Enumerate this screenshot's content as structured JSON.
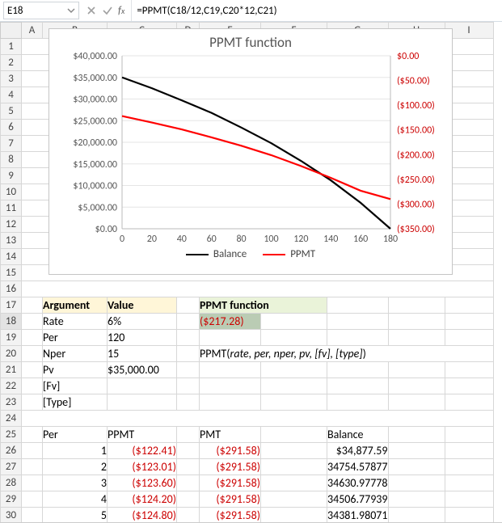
{
  "namebox": "E18",
  "formula": "=PPMT(C18/12,C19,C20*12,C21)",
  "col_headers": [
    "A",
    "B",
    "C",
    "D",
    "E",
    "F",
    "G",
    "H",
    "I"
  ],
  "row_headers": [
    "1",
    "2",
    "3",
    "4",
    "5",
    "6",
    "7",
    "8",
    "9",
    "10",
    "11",
    "12",
    "13",
    "14",
    "15",
    "16",
    "17",
    "18",
    "19",
    "20",
    "21",
    "22",
    "23",
    "24",
    "25",
    "26",
    "27",
    "28",
    "29",
    "30"
  ],
  "args_header": {
    "arg": "Argument",
    "val": "Value"
  },
  "args": [
    {
      "name": "Rate",
      "value": "6%"
    },
    {
      "name": "Per",
      "value": "120"
    },
    {
      "name": "Nper",
      "value": "15"
    },
    {
      "name": "Pv",
      "value": "$35,000.00"
    },
    {
      "name": "[Fv]",
      "value": ""
    },
    {
      "name": "[Type]",
      "value": ""
    }
  ],
  "ppmt_title": "PPMT function",
  "ppmt_result": "($217.28)",
  "syntax_prefix": "PPMT(",
  "syntax_args": "rate, per, nper, pv, [fv], [type]",
  "syntax_suffix": ")",
  "table_header": {
    "per": "Per",
    "ppmt": "PPMT",
    "pmt": "PMT",
    "bal": "Balance"
  },
  "table_rows": [
    {
      "per": "1",
      "ppmt": "($122.41)",
      "pmt": "($291.58)",
      "bal": "$34,877.59"
    },
    {
      "per": "2",
      "ppmt": "($123.01)",
      "pmt": "($291.58)",
      "bal": "34754.57877"
    },
    {
      "per": "3",
      "ppmt": "($123.60)",
      "pmt": "($291.58)",
      "bal": "34630.97778"
    },
    {
      "per": "4",
      "ppmt": "($124.20)",
      "pmt": "($291.58)",
      "bal": "34506.77939"
    },
    {
      "per": "5",
      "ppmt": "($124.80)",
      "pmt": "($291.58)",
      "bal": "34381.98071"
    }
  ],
  "chart_data": {
    "type": "line",
    "title": "PPMT function",
    "x": {
      "label": "",
      "min": 0,
      "max": 180,
      "ticks": [
        0,
        20,
        40,
        60,
        80,
        100,
        120,
        140,
        160,
        180
      ]
    },
    "y_left": {
      "label": "",
      "min": 0,
      "max": 40000,
      "ticks": [
        "$0.00",
        "$5,000.00",
        "$10,000.00",
        "$15,000.00",
        "$20,000.00",
        "$25,000.00",
        "$30,000.00",
        "$35,000.00",
        "$40,000.00"
      ]
    },
    "y_right": {
      "label": "",
      "min": -350,
      "max": 0,
      "ticks": [
        "$0.00",
        "($50.00)",
        "($100.00)",
        "($150.00)",
        "($200.00)",
        "($250.00)",
        "($300.00)",
        "($350.00)"
      ]
    },
    "series": [
      {
        "name": "Balance",
        "axis": "left",
        "color": "#000000",
        "x": [
          0,
          20,
          40,
          60,
          80,
          100,
          120,
          140,
          160,
          180
        ],
        "y": [
          35000,
          32500,
          29700,
          26800,
          23400,
          19800,
          15700,
          11200,
          6000,
          0
        ]
      },
      {
        "name": "PPMT",
        "axis": "right",
        "color": "#ff0000",
        "x": [
          0,
          20,
          40,
          60,
          80,
          100,
          120,
          140,
          160,
          180
        ],
        "y": [
          -122,
          -135,
          -149,
          -165,
          -182,
          -201,
          -223,
          -247,
          -273,
          -290
        ]
      }
    ],
    "legend": [
      "Balance",
      "PPMT"
    ]
  }
}
